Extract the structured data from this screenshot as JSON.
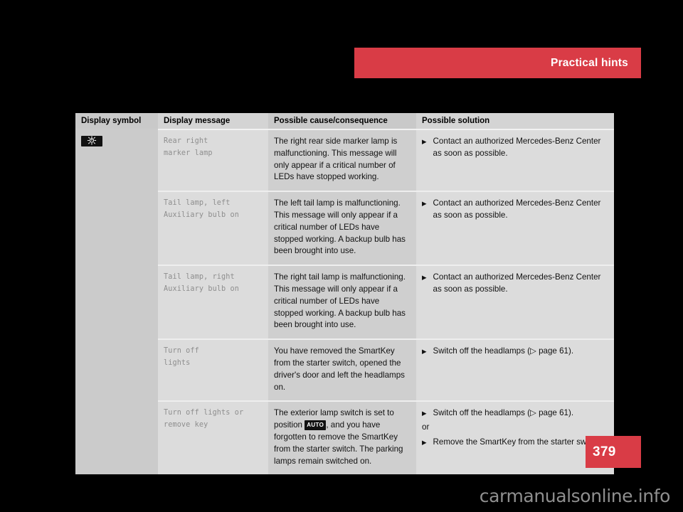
{
  "page": {
    "header_title": "Practical hints",
    "page_number": "379",
    "watermark": "carmanualsonline.info",
    "accent_color": "#d93c46"
  },
  "table": {
    "columns": [
      {
        "key": "symbol",
        "label": "Display symbol"
      },
      {
        "key": "message",
        "label": "Display message"
      },
      {
        "key": "cause",
        "label": "Possible cause/consequence"
      },
      {
        "key": "solution",
        "label": "Possible solution"
      }
    ],
    "rows": [
      {
        "symbol_icon": "side-marker-lamp-icon",
        "message": "Rear right\nmarker lamp",
        "cause": "The right rear side marker lamp is malfunctioning. This message will only appear if a critical number of LEDs have stopped working.",
        "solutions": [
          {
            "type": "action",
            "text": "Contact an authorized Mercedes-Benz Center as soon as possible."
          }
        ]
      },
      {
        "symbol_icon": null,
        "message": "Tail lamp, left\nAuxiliary bulb on",
        "cause": "The left tail lamp is malfunctioning. This message will only appear if a critical number of LEDs have stopped working. A backup bulb has been brought into use.",
        "solutions": [
          {
            "type": "action",
            "text": "Contact an authorized Mercedes-Benz Center as soon as possible."
          }
        ]
      },
      {
        "symbol_icon": null,
        "message": "Tail lamp, right\nAuxiliary bulb on",
        "cause": "The right tail lamp is malfunctioning. This message will only appear if a critical number of LEDs have stopped working. A backup bulb has been brought into use.",
        "solutions": [
          {
            "type": "action",
            "text": "Contact an authorized Mercedes-Benz Center as soon as possible."
          }
        ]
      },
      {
        "symbol_icon": null,
        "message": "Turn off\nlights",
        "cause": "You have removed the SmartKey from the starter switch, opened the driver's door and left the headlamps on.",
        "solutions": [
          {
            "type": "action",
            "text": "Switch off the headlamps (▷ page 61)."
          }
        ]
      },
      {
        "symbol_icon": null,
        "message": "Turn off lights or\nremove key",
        "cause_parts": [
          {
            "kind": "text",
            "value": "The exterior lamp switch is set to position "
          },
          {
            "kind": "badge",
            "value": "AUTO"
          },
          {
            "kind": "text",
            "value": ", and you have forgotten to remove the SmartKey from the starter switch. The parking lamps remain switched on."
          }
        ],
        "solutions": [
          {
            "type": "action",
            "text": "Switch off the headlamps (▷ page 61)."
          },
          {
            "type": "or",
            "text": "or"
          },
          {
            "type": "action",
            "text": "Remove the SmartKey from the starter switch."
          }
        ]
      }
    ]
  }
}
